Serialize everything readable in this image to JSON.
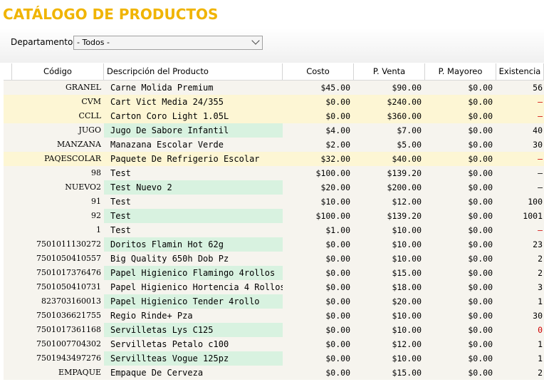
{
  "page": {
    "title": "CATÁLOGO DE PRODUCTOS",
    "department_label": "Departamento:",
    "department_value": "- Todos -"
  },
  "colors": {
    "title": "#f0b400",
    "row_white": "#f6f4ee",
    "row_yellow": "#fdf6d4",
    "desc_green": "#d8f2e0",
    "negative": "#d00000"
  },
  "table": {
    "headers": [
      "Código",
      "Descripción del Producto",
      "Costo",
      "P. Venta",
      "P. Mayoreo",
      "Existencia"
    ],
    "rows": [
      {
        "code": "GRANEL",
        "desc": "Carne Molida Premium",
        "cost": "$45.00",
        "price": "$90.00",
        "wholesale": "$0.00",
        "stock": "56",
        "style": "w",
        "green": false,
        "neg": false
      },
      {
        "code": "CVM",
        "desc": "Cart Vict Media 24/355",
        "cost": "$0.00",
        "price": "$240.00",
        "wholesale": "$0.00",
        "stock": "–",
        "style": "y",
        "green": false,
        "neg": true
      },
      {
        "code": "CCLL",
        "desc": "Carton Coro Light 1.05L",
        "cost": "$0.00",
        "price": "$360.00",
        "wholesale": "$0.00",
        "stock": "–",
        "style": "y",
        "green": false,
        "neg": true
      },
      {
        "code": "JUGO",
        "desc": "Jugo De Sabore Infantil",
        "cost": "$4.00",
        "price": "$7.00",
        "wholesale": "$0.00",
        "stock": "40",
        "style": "w",
        "green": true,
        "neg": false
      },
      {
        "code": "MANZANA",
        "desc": "Manazana Escolar Verde",
        "cost": "$2.00",
        "price": "$5.00",
        "wholesale": "$0.00",
        "stock": "30",
        "style": "w",
        "green": false,
        "neg": false
      },
      {
        "code": "PAQESCOLAR",
        "desc": "Paquete De Refrigerio Escolar",
        "cost": "$32.00",
        "price": "$40.00",
        "wholesale": "$0.00",
        "stock": "–",
        "style": "y",
        "green": false,
        "neg": true
      },
      {
        "code": "98",
        "desc": "Test",
        "cost": "$100.00",
        "price": "$139.20",
        "wholesale": "$0.00",
        "stock": "–",
        "style": "w",
        "green": false,
        "neg": false
      },
      {
        "code": "NUEVO2",
        "desc": "Test Nuevo 2",
        "cost": "$20.00",
        "price": "$200.00",
        "wholesale": "$0.00",
        "stock": "–",
        "style": "w",
        "green": true,
        "neg": false
      },
      {
        "code": "91",
        "desc": "Test",
        "cost": "$10.00",
        "price": "$12.00",
        "wholesale": "$0.00",
        "stock": "100",
        "style": "w",
        "green": false,
        "neg": false
      },
      {
        "code": "92",
        "desc": "Test",
        "cost": "$100.00",
        "price": "$139.20",
        "wholesale": "$0.00",
        "stock": "1001",
        "style": "w",
        "green": true,
        "neg": false
      },
      {
        "code": "1",
        "desc": "Test",
        "cost": "$1.00",
        "price": "$10.00",
        "wholesale": "$0.00",
        "stock": "–",
        "style": "w",
        "green": false,
        "neg": true
      },
      {
        "code": "7501011130272",
        "desc": "Doritos Flamin Hot 62g",
        "cost": "$0.00",
        "price": "$10.00",
        "wholesale": "$0.00",
        "stock": "23",
        "style": "w",
        "green": true,
        "neg": false
      },
      {
        "code": "7501050410557",
        "desc": "Big Quality 650h Dob Pz",
        "cost": "$0.00",
        "price": "$10.00",
        "wholesale": "$0.00",
        "stock": "2",
        "style": "w",
        "green": false,
        "neg": false
      },
      {
        "code": "7501017376476",
        "desc": "Papel Higienico Flamingo 4rollos",
        "cost": "$0.00",
        "price": "$15.00",
        "wholesale": "$0.00",
        "stock": "2",
        "style": "w",
        "green": true,
        "neg": false
      },
      {
        "code": "7501050410731",
        "desc": "Papel Higienico Hortencia 4 Rollos",
        "cost": "$0.00",
        "price": "$18.00",
        "wholesale": "$0.00",
        "stock": "3",
        "style": "w",
        "green": false,
        "neg": false
      },
      {
        "code": "823703160013",
        "desc": "Papel Higienico Tender 4rollo",
        "cost": "$0.00",
        "price": "$20.00",
        "wholesale": "$0.00",
        "stock": "1",
        "style": "w",
        "green": true,
        "neg": false
      },
      {
        "code": "7501036621755",
        "desc": "Regio Rinde+ Pza",
        "cost": "$0.00",
        "price": "$10.00",
        "wholesale": "$0.00",
        "stock": "30",
        "style": "w",
        "green": false,
        "neg": false
      },
      {
        "code": "7501017361168",
        "desc": "Servilletas Lys C125",
        "cost": "$0.00",
        "price": "$10.00",
        "wholesale": "$0.00",
        "stock": "0",
        "style": "w",
        "green": true,
        "neg": true
      },
      {
        "code": "7501007704302",
        "desc": "Servilletas Petalo c100",
        "cost": "$0.00",
        "price": "$12.00",
        "wholesale": "$0.00",
        "stock": "1",
        "style": "w",
        "green": false,
        "neg": false
      },
      {
        "code": "7501943497276",
        "desc": "Servillteas Vogue 125pz",
        "cost": "$0.00",
        "price": "$10.00",
        "wholesale": "$0.00",
        "stock": "1",
        "style": "w",
        "green": true,
        "neg": false
      },
      {
        "code": "EMPAQUE",
        "desc": "Empaque De Cerveza",
        "cost": "$0.00",
        "price": "$15.00",
        "wholesale": "$0.00",
        "stock": "2",
        "style": "w",
        "green": false,
        "neg": false
      }
    ]
  }
}
